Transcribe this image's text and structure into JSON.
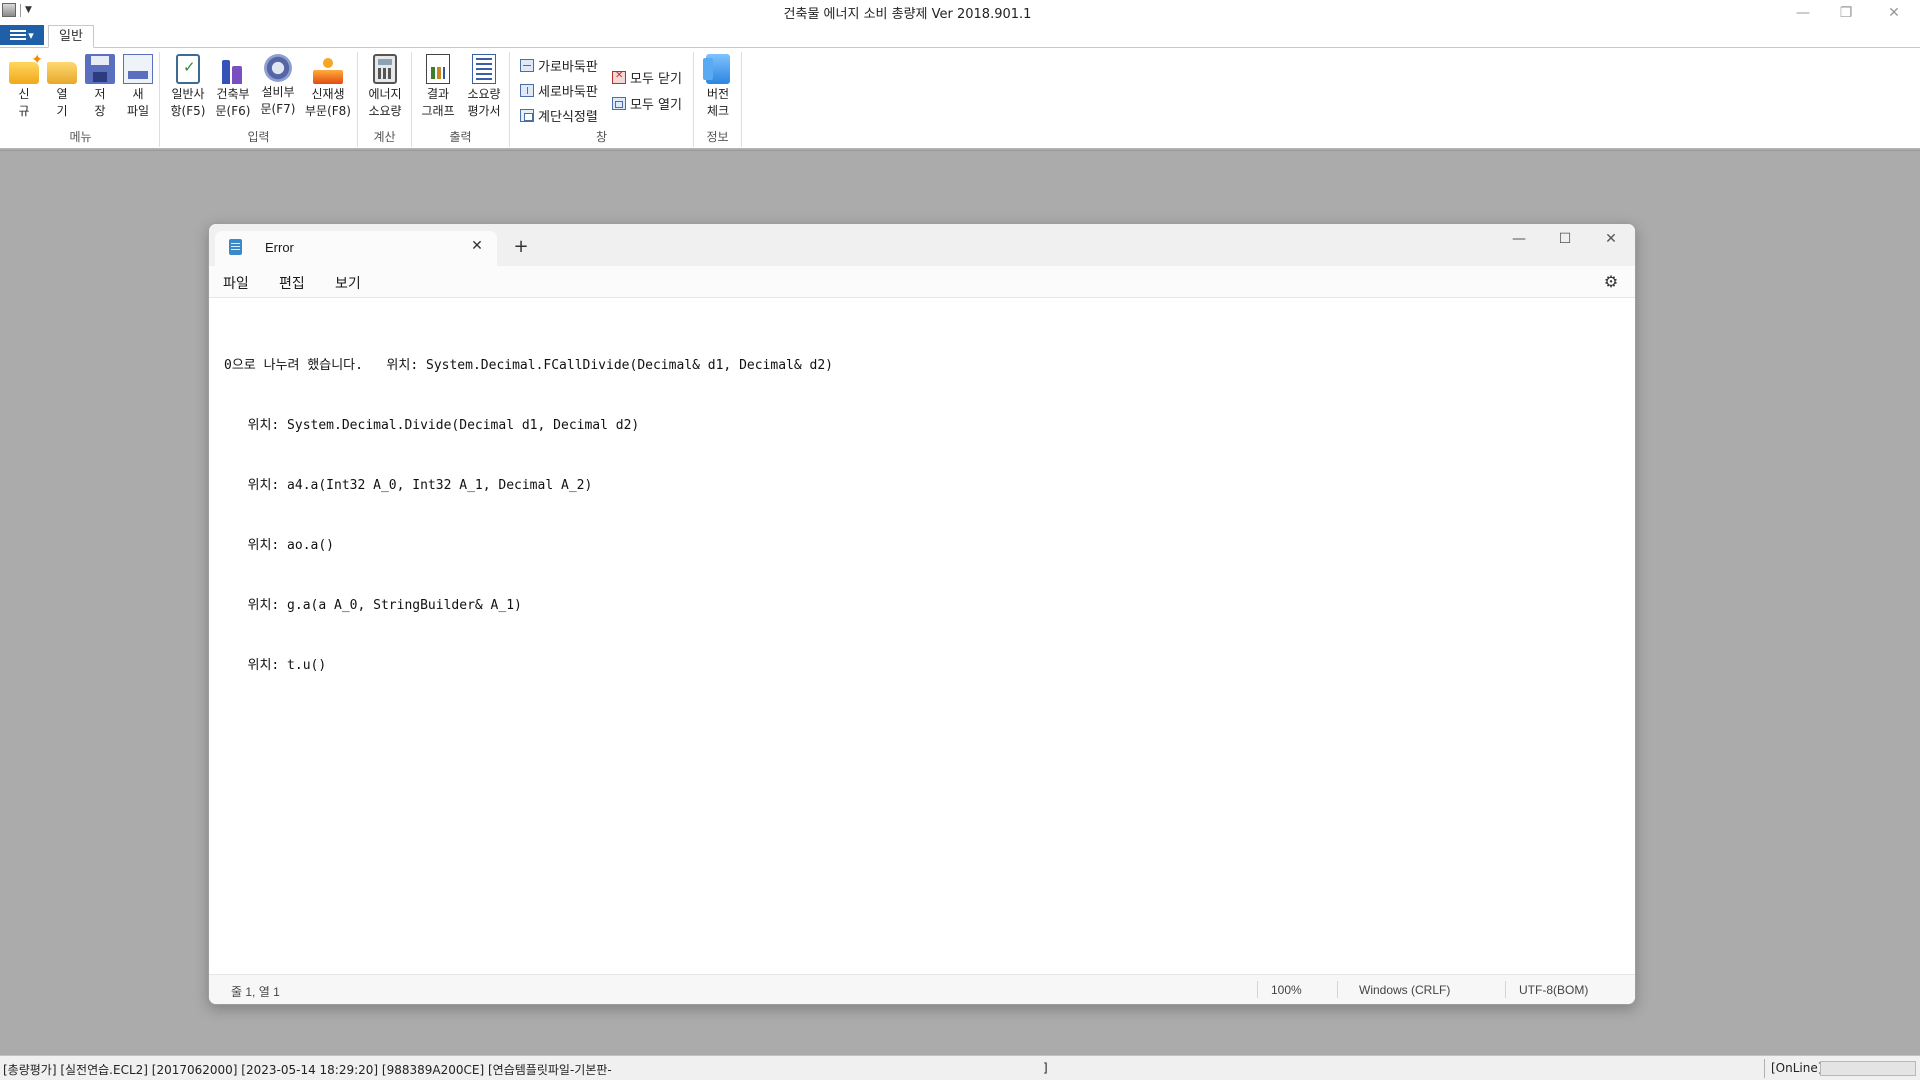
{
  "app": {
    "title": "건축물 에너지 소비 총량제 Ver 2018.901.1",
    "controls": {
      "minimize": "—",
      "restore": "❐",
      "close": "✕"
    }
  },
  "ribbon": {
    "file_menu_icon": "hamburger-menu-icon",
    "tabs": [
      {
        "label": "일반",
        "active": true
      }
    ],
    "groups": [
      {
        "label": "메뉴",
        "buttons": [
          {
            "line1": "신",
            "line2": "규",
            "icon": "new-folder-icon"
          },
          {
            "line1": "열",
            "line2": "기",
            "icon": "open-folder-icon"
          },
          {
            "line1": "저",
            "line2": "장",
            "icon": "save-disk-icon"
          },
          {
            "line1": "새",
            "line2": "파일",
            "icon": "new-file-icon"
          }
        ]
      },
      {
        "label": "입력",
        "buttons": [
          {
            "line1": "일반사",
            "line2": "항(F5)",
            "icon": "clipboard-check-icon"
          },
          {
            "line1": "건축부",
            "line2": "문(F6)",
            "icon": "building-icon"
          },
          {
            "line1": "설비부",
            "line2": "문(F7)",
            "icon": "fan-icon"
          },
          {
            "line1": "신재생",
            "line2": "부문(F8)",
            "icon": "solar-panel-icon"
          }
        ]
      },
      {
        "label": "계산",
        "buttons": [
          {
            "line1": "에너지",
            "line2": "소요량",
            "icon": "calculator-icon"
          }
        ]
      },
      {
        "label": "출력",
        "buttons": [
          {
            "line1": "결과",
            "line2": "그래프",
            "icon": "chart-document-icon"
          },
          {
            "line1": "소요량",
            "line2": "평가서",
            "icon": "report-icon"
          }
        ]
      },
      {
        "label": "창",
        "small_buttons": [
          {
            "label": "가로바둑판",
            "icon": "tile-horizontal-icon"
          },
          {
            "label": "세로바둑판",
            "icon": "tile-vertical-icon"
          },
          {
            "label": "계단식정렬",
            "icon": "cascade-icon"
          },
          {
            "label": "모두 닫기",
            "icon": "close-all-icon"
          },
          {
            "label": "모두 열기",
            "icon": "open-all-icon"
          }
        ]
      },
      {
        "label": "정보",
        "buttons": [
          {
            "line1": "버전",
            "line2": "체크",
            "icon": "version-check-icon"
          }
        ]
      }
    ]
  },
  "notepad": {
    "tab_title": "Error",
    "tab_close": "✕",
    "new_tab": "+",
    "window_controls": {
      "minimize": "—",
      "maximize": "☐",
      "close": "✕"
    },
    "menu": [
      "파일",
      "편집",
      "보기"
    ],
    "settings_icon": "⚙",
    "content_lines": [
      "0으로 나누려 했습니다.   위치: System.Decimal.FCallDivide(Decimal& d1, Decimal& d2)",
      "   위치: System.Decimal.Divide(Decimal d1, Decimal d2)",
      "   위치: a4.a(Int32 A_0, Int32 A_1, Decimal A_2)",
      "   위치: ao.a()",
      "   위치: g.a(a A_0, StringBuilder& A_1)",
      "   위치: t.u()"
    ],
    "status": {
      "position": "줄 1, 열 1",
      "zoom": "100%",
      "line_ending": "Windows (CRLF)",
      "encoding": "UTF-8(BOM)"
    }
  },
  "status_bar": {
    "text": "[총량평가] [실전연습.ECL2]  [2017062000]  [2023-05-14 18:29:20]  [988389A200CE]  [연습템플릿파일-기본판-",
    "bracket": "]",
    "online": "[OnLine]"
  }
}
